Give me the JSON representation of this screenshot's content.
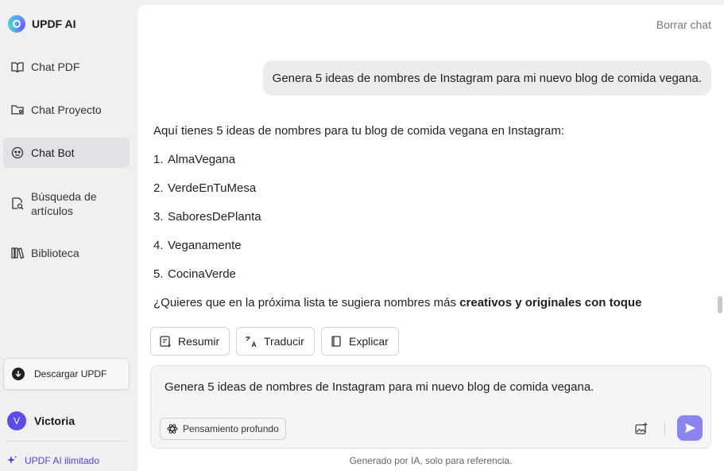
{
  "app": {
    "name": "UPDF AI"
  },
  "sidebar": {
    "items": [
      {
        "label": "Chat PDF",
        "icon": "book-icon"
      },
      {
        "label": "Chat Proyecto",
        "icon": "folder-icon"
      },
      {
        "label": "Chat Bot",
        "icon": "bot-icon",
        "active": true
      },
      {
        "label": "Búsqueda de artículos",
        "icon": "article-search-icon"
      },
      {
        "label": "Biblioteca",
        "icon": "library-icon"
      }
    ],
    "download_label": "Descargar UPDF",
    "user": {
      "initial": "V",
      "name": "Victoria"
    },
    "upgrade_label": "UPDF AI ilimitado"
  },
  "header": {
    "clear_chat": "Borrar chat"
  },
  "conversation": {
    "user_message": "Genera 5 ideas de nombres de Instagram para mi nuevo blog de comida vegana.",
    "answer": {
      "intro": "Aquí tienes 5 ideas de nombres para tu blog de comida vegana en Instagram:",
      "items": [
        {
          "num": "1.",
          "text": "AlmaVegana"
        },
        {
          "num": "2.",
          "text": "VerdeEnTuMesa"
        },
        {
          "num": "3.",
          "text": "SaboresDePlanta"
        },
        {
          "num": "4.",
          "text": "Veganamente"
        },
        {
          "num": "5.",
          "text": "CocinaVerde"
        }
      ],
      "followup_plain": "¿Quieres que en la próxima lista te sugiera nombres más ",
      "followup_bold": "creativos y originales con toque"
    }
  },
  "actions": {
    "summarize": "Resumir",
    "translate": "Traducir",
    "explain": "Explicar"
  },
  "composer": {
    "text": "Genera 5 ideas de nombres de Instagram para mi nuevo blog de comida vegana.",
    "deep_thinking": "Pensamiento profundo"
  },
  "footer": "Generado por IA, solo para referencia.",
  "colors": {
    "accent": "#5b4de8",
    "send": "#8c84f0",
    "active_bg": "#e2e2e6"
  }
}
